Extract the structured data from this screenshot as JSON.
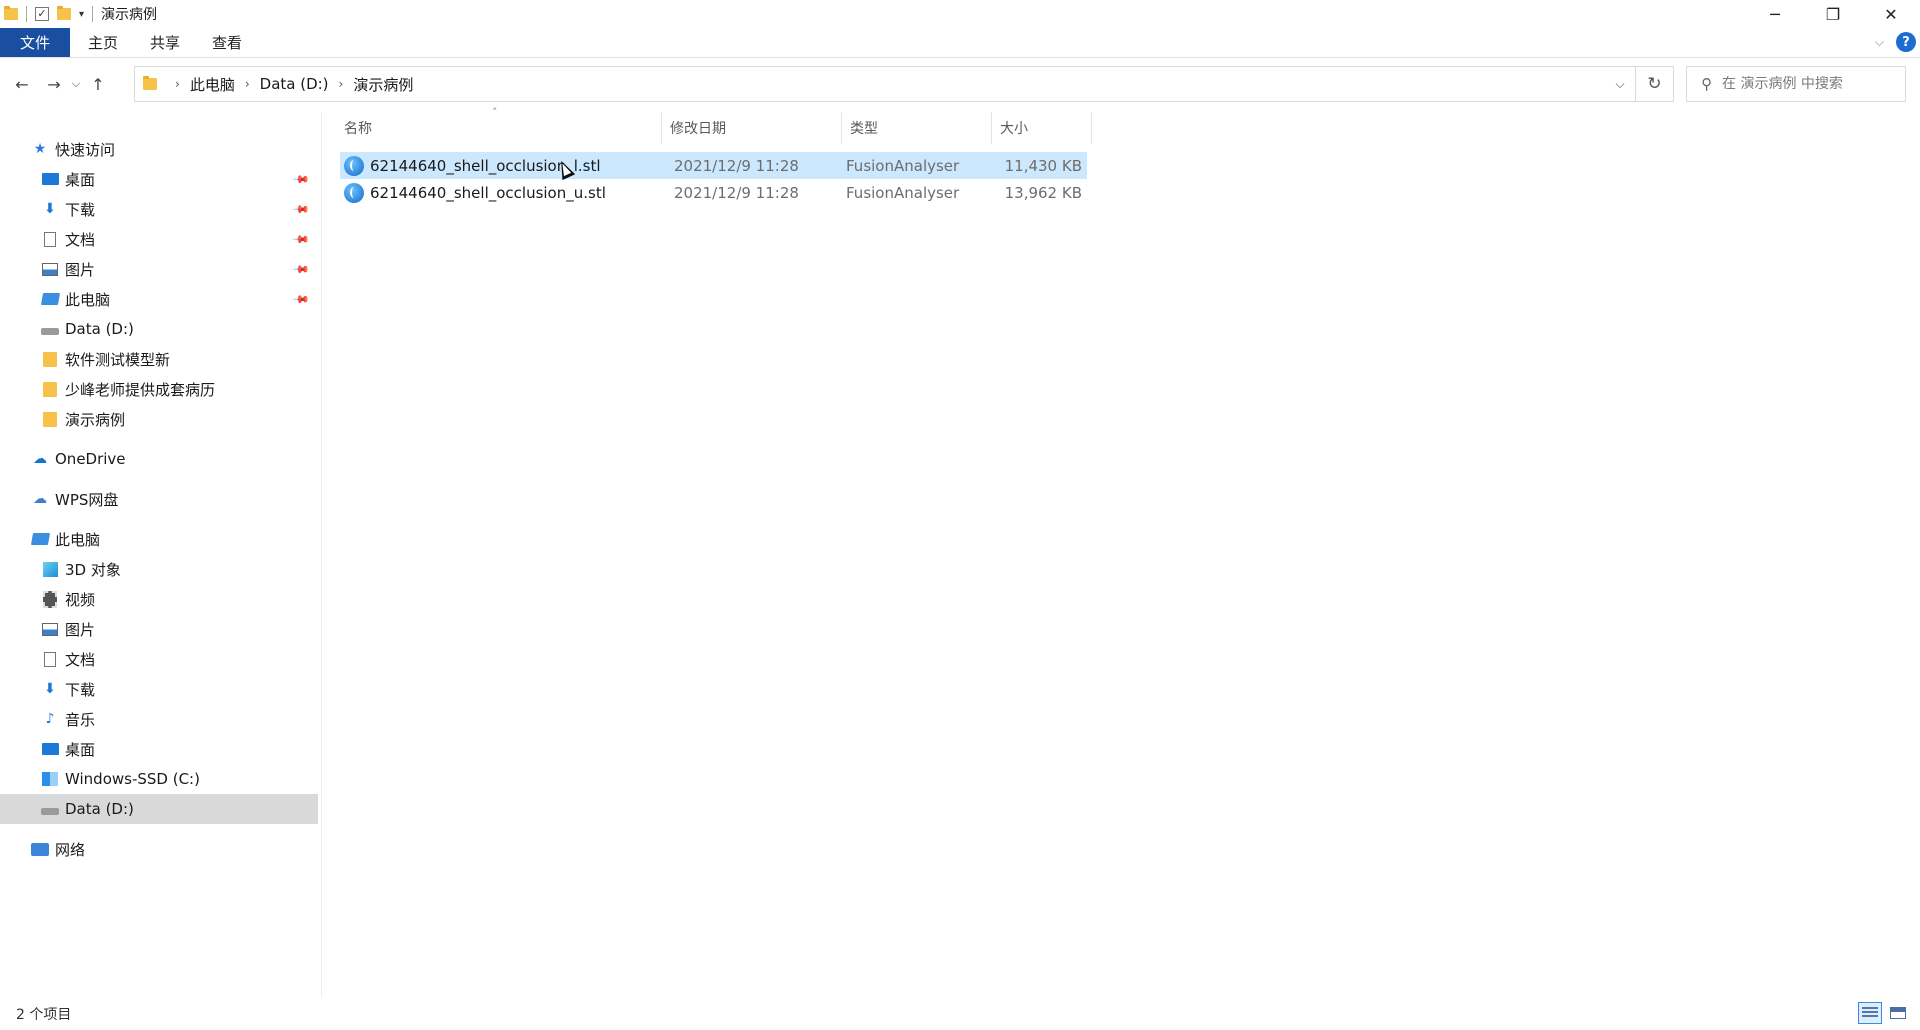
{
  "window": {
    "title": "演示病例",
    "minimize": "─",
    "maximize": "❐",
    "close": "✕"
  },
  "ribbon": {
    "tabs": [
      "文件",
      "主页",
      "共享",
      "查看"
    ],
    "help": "?"
  },
  "address": {
    "crumbs": [
      "此电脑",
      "Data (D:)",
      "演示病例"
    ],
    "search_placeholder": "在 演示病例 中搜索"
  },
  "sidebar": {
    "quick_access": "快速访问",
    "quick_items": [
      "桌面",
      "下载",
      "文档",
      "图片",
      "此电脑",
      "Data (D:)",
      "软件测试模型新",
      "少峰老师提供成套病历",
      "演示病例"
    ],
    "onedrive": "OneDrive",
    "wps": "WPS网盘",
    "this_pc": "此电脑",
    "pc_items": [
      "3D 对象",
      "视频",
      "图片",
      "文档",
      "下载",
      "音乐",
      "桌面",
      "Windows-SSD (C:)",
      "Data (D:)"
    ],
    "network": "网络"
  },
  "columns": {
    "name": "名称",
    "date": "修改日期",
    "type": "类型",
    "size": "大小"
  },
  "files": [
    {
      "name": "62144640_shell_occlusion_l.stl",
      "date": "2021/12/9 11:28",
      "type": "FusionAnalyser",
      "size": "11,430 KB"
    },
    {
      "name": "62144640_shell_occlusion_u.stl",
      "date": "2021/12/9 11:28",
      "type": "FusionAnalyser",
      "size": "13,962 KB"
    }
  ],
  "status": {
    "count": "2 个项目"
  }
}
